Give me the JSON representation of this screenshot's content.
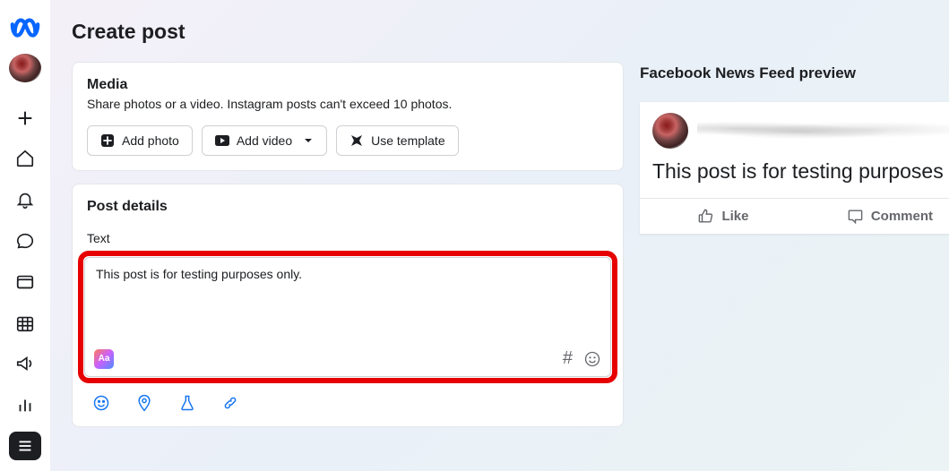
{
  "page_title": "Create post",
  "media": {
    "title": "Media",
    "subtitle": "Share photos or a video. Instagram posts can't exceed 10 photos.",
    "add_photo_label": "Add photo",
    "add_video_label": "Add video",
    "use_template_label": "Use template"
  },
  "post_details": {
    "title": "Post details",
    "text_label": "Text",
    "text_value": "This post is for testing purposes only.",
    "aa_label": "Aa",
    "hashtag_symbol": "#"
  },
  "preview": {
    "title": "Facebook News Feed preview",
    "text": "This post is for testing purposes o",
    "like_label": "Like",
    "comment_label": "Comment"
  }
}
